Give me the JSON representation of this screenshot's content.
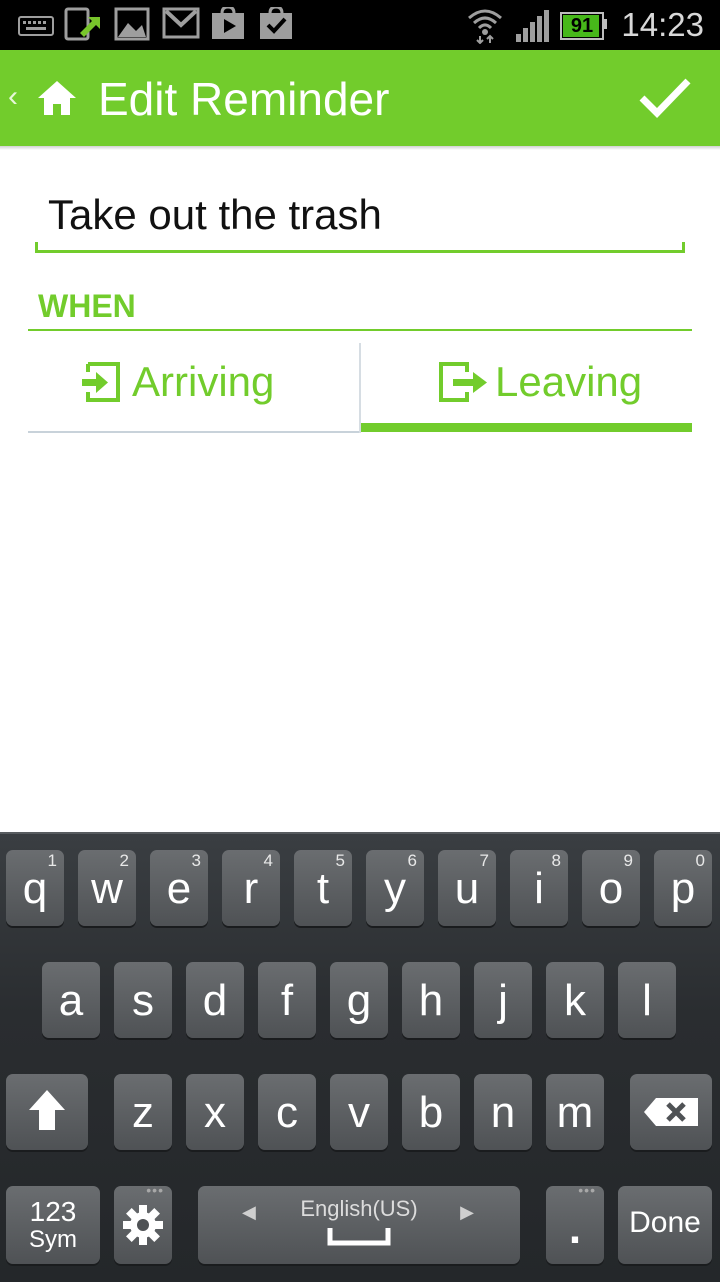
{
  "status_bar": {
    "time": "14:23",
    "battery": "91",
    "icons": [
      "keyboard-icon",
      "sync-icon",
      "gallery-icon",
      "gmail-icon",
      "play-store-icon",
      "shopping-icon",
      "wifi-icon",
      "signal-icon",
      "battery-icon"
    ]
  },
  "action_bar": {
    "title": "Edit Reminder",
    "icons": [
      "back-chevron-icon",
      "home-icon",
      "checkmark-icon"
    ]
  },
  "reminder": {
    "title_value": "Take out the trash"
  },
  "when": {
    "header": "WHEN",
    "tabs": [
      {
        "label": "Arriving",
        "icon": "arriving-icon",
        "selected": false
      },
      {
        "label": "Leaving",
        "icon": "leaving-icon",
        "selected": true
      }
    ]
  },
  "keyboard": {
    "row1": [
      {
        "ch": "q",
        "num": "1"
      },
      {
        "ch": "w",
        "num": "2"
      },
      {
        "ch": "e",
        "num": "3"
      },
      {
        "ch": "r",
        "num": "4"
      },
      {
        "ch": "t",
        "num": "5"
      },
      {
        "ch": "y",
        "num": "6"
      },
      {
        "ch": "u",
        "num": "7"
      },
      {
        "ch": "i",
        "num": "8"
      },
      {
        "ch": "o",
        "num": "9"
      },
      {
        "ch": "p",
        "num": "0"
      }
    ],
    "row2": [
      "a",
      "s",
      "d",
      "f",
      "g",
      "h",
      "j",
      "k",
      "l"
    ],
    "row3": [
      "z",
      "x",
      "c",
      "v",
      "b",
      "n",
      "m"
    ],
    "sym_top": "123",
    "sym_bottom": "Sym",
    "language": "English(US)",
    "period": ".",
    "done": "Done"
  },
  "colors": {
    "accent": "#72cc2c",
    "status_bar_bg": "#000000",
    "keyboard_bg": "#2a2d30",
    "key_bg": "#5d6063"
  }
}
